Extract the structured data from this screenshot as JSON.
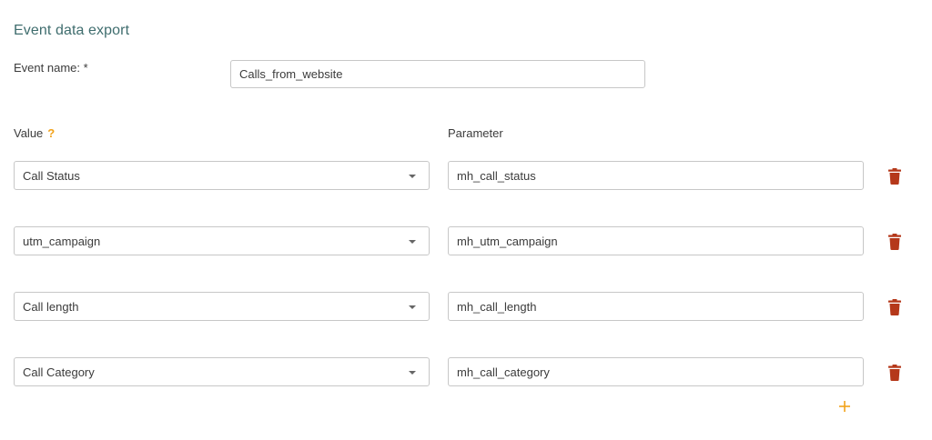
{
  "title": "Event data export",
  "event_name": {
    "label": "Event name: *",
    "value": "Calls_from_website"
  },
  "columns": {
    "value_header": "Value",
    "value_help": "?",
    "parameter_header": "Parameter"
  },
  "rows": [
    {
      "value": "Call Status",
      "parameter": "mh_call_status"
    },
    {
      "value": "utm_campaign",
      "parameter": "mh_utm_campaign"
    },
    {
      "value": "Call length",
      "parameter": "mh_call_length"
    },
    {
      "value": "Call Category",
      "parameter": "mh_call_category"
    }
  ],
  "icons": {
    "dropdown": "chevron-down-icon",
    "delete": "trash-icon",
    "add": "plus-icon"
  },
  "colors": {
    "title": "#3f6d6e",
    "help": "#f2a31c",
    "trash": "#b5381a",
    "add": "#f2a31c"
  }
}
